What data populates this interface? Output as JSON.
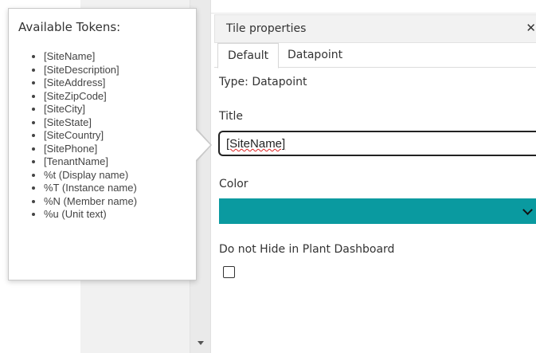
{
  "popover": {
    "title": "Available Tokens:",
    "tokens": [
      "[SiteName]",
      "[SiteDescription]",
      "[SiteAddress]",
      "[SiteZipCode]",
      "[SiteCity]",
      "[SiteState]",
      "[SiteCountry]",
      "[SitePhone]",
      "[TenantName]",
      "%t (Display name)",
      "%T (Instance name)",
      "%N (Member name)",
      "%u (Unit text)"
    ]
  },
  "panel": {
    "title": "Tile properties",
    "close_icon": "close-icon",
    "tabs": [
      {
        "label": "Default",
        "active": true
      },
      {
        "label": "Datapoint",
        "active": false
      }
    ],
    "type_text": "Type: Datapoint",
    "title_label": "Title",
    "title_value": "[SiteName]",
    "color_label": "Color",
    "color_value": "#0a9aa0",
    "checkbox_label": "Do not Hide in Plant Dashboard",
    "checkbox_checked": false
  }
}
